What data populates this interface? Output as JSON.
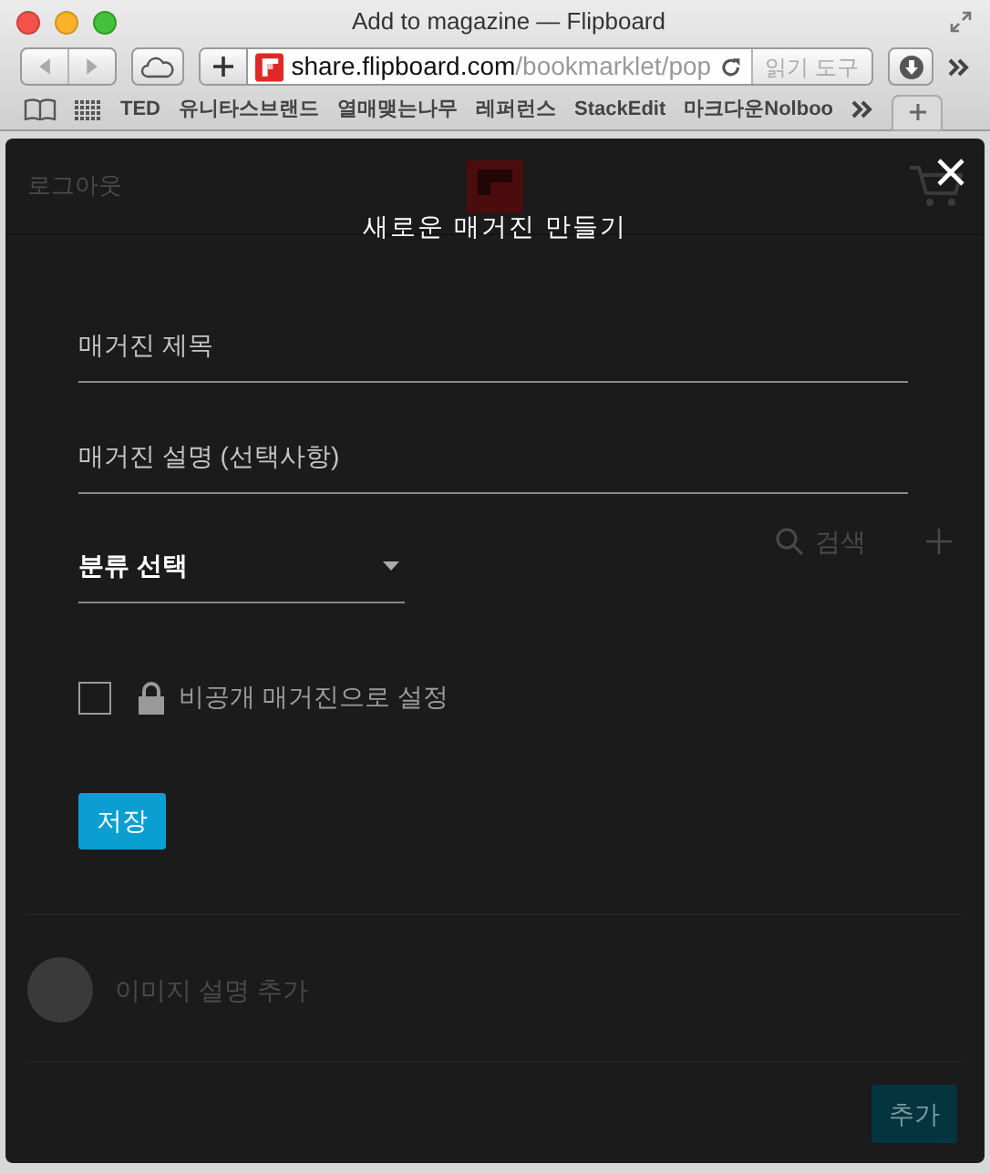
{
  "window": {
    "title": "Add to magazine — Flipboard"
  },
  "toolbar": {
    "url_host": "share.flipboard.com",
    "url_path": "/bookmarklet/pop",
    "reader_button": "읽기 도구"
  },
  "bookmarks": [
    "TED",
    "유니타스브랜드",
    "열매맺는나무",
    "레퍼런스",
    "StackEdit",
    "마크다운Nolboo"
  ],
  "page": {
    "logout": "로그아웃",
    "search_label": "검색",
    "caption_placeholder": "이미지 설명 추가",
    "add_button": "추가"
  },
  "dialog": {
    "title": "새로운 매거진 만들기",
    "fields": [
      {
        "placeholder": "매거진 제목"
      },
      {
        "placeholder": "매거진 설명 (선택사항)"
      }
    ],
    "category": {
      "value": "분류 선택"
    },
    "private": {
      "label": "비공개 매거진으로 설정",
      "checked": false
    },
    "save_button": "저장"
  }
}
